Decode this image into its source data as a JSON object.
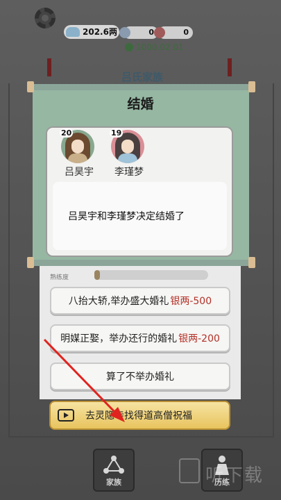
{
  "topbar": {
    "silver": "202.6两",
    "stat1": "0",
    "stat2": "0",
    "timer": "1000.02.01"
  },
  "background": {
    "family_title": "吕氏家族"
  },
  "modal": {
    "title": "结婚",
    "groom": {
      "name": "吕昊宇",
      "age": "20"
    },
    "bride": {
      "name": "李瑾梦",
      "age": "19"
    },
    "message": "吕昊宇和李瑾梦决定结婚了"
  },
  "choices": {
    "proficiency_label": "熟练度",
    "option1": {
      "text": "八抬大轿,举办盛大婚礼",
      "cost": "银两-500"
    },
    "option2": {
      "text": "明媒正娶，举办还行的婚礼",
      "cost": "银两-200"
    },
    "option3": {
      "text": "算了不举办婚礼"
    },
    "option4": {
      "text": "去灵隐寺找得道高僧祝福"
    }
  },
  "nav": {
    "family_label": "家族",
    "right_label": "历练"
  },
  "watermark": "听下载",
  "colors": {
    "modal_bg": "#96b7a2",
    "cost_red": "#b33027",
    "gold_button": "#e8c45e",
    "arrow_red": "#e0231f"
  }
}
